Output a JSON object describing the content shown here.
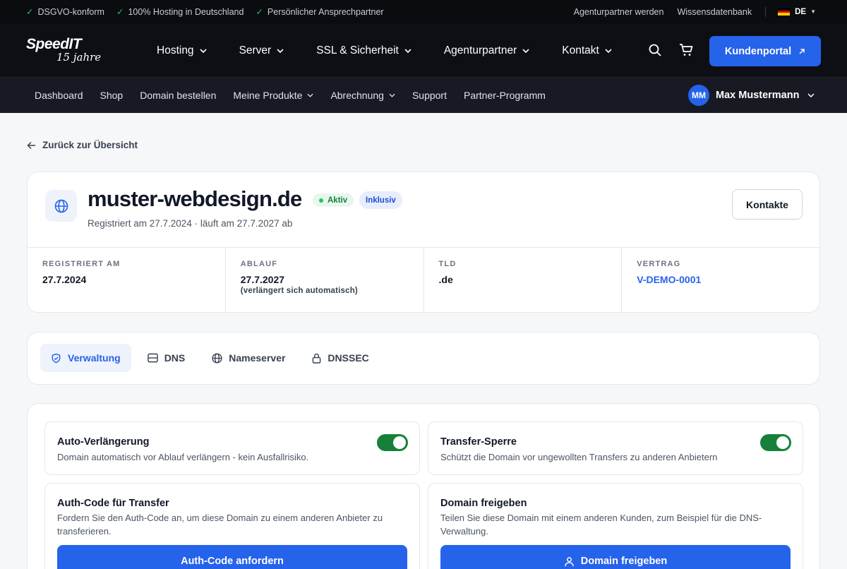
{
  "topbar": {
    "badges": [
      "DSGVO-konform",
      "100% Hosting in Deutschland",
      "Persönlicher Ansprechpartner"
    ],
    "links": [
      "Agenturpartner werden",
      "Wissensdatenbank"
    ],
    "language": "DE"
  },
  "logo": {
    "name": "SpeedIT",
    "tagline": "15 jahre"
  },
  "nav": {
    "items": [
      "Hosting",
      "Server",
      "SSL & Sicherheit",
      "Agenturpartner",
      "Kontakt"
    ],
    "portal_button": "Kundenportal"
  },
  "subnav": {
    "items": [
      {
        "label": "Dashboard",
        "dropdown": false
      },
      {
        "label": "Shop",
        "dropdown": false
      },
      {
        "label": "Domain bestellen",
        "dropdown": false
      },
      {
        "label": "Meine Produkte",
        "dropdown": true
      },
      {
        "label": "Abrechnung",
        "dropdown": true
      },
      {
        "label": "Support",
        "dropdown": false
      },
      {
        "label": "Partner-Programm",
        "dropdown": false
      }
    ],
    "user": {
      "initials": "MM",
      "name": "Max Mustermann"
    }
  },
  "back_link": "Zurück zur Übersicht",
  "domain": {
    "name": "muster-webdesign.de",
    "status": "Aktiv",
    "plan": "Inklusiv",
    "subtitle": "Registriert am 27.7.2024 · läuft am 27.7.2027 ab",
    "contacts_button": "Kontakte",
    "stats": {
      "registered_label": "REGISTRIERT AM",
      "registered_value": "27.7.2024",
      "expiry_label": "ABLAUF",
      "expiry_value": "27.7.2027",
      "expiry_note": "(verlängert sich automatisch)",
      "tld_label": "TLD",
      "tld_value": ".de",
      "contract_label": "VERTRAG",
      "contract_value": "V-DEMO-0001"
    }
  },
  "tabs": [
    "Verwaltung",
    "DNS",
    "Nameserver",
    "DNSSEC"
  ],
  "active_tab": "Verwaltung",
  "settings": {
    "auto_renew": {
      "title": "Auto-Verlängerung",
      "desc": "Domain automatisch vor Ablauf verlängern - kein Ausfallrisiko.",
      "enabled": true
    },
    "transfer_lock": {
      "title": "Transfer-Sperre",
      "desc": "Schützt die Domain vor ungewollten Transfers zu anderen Anbietern",
      "enabled": true
    },
    "auth_code": {
      "title": "Auth-Code für Transfer",
      "desc": "Fordern Sie den Auth-Code an, um diese Domain zu einem anderen Anbieter zu transferieren.",
      "button": "Auth-Code anfordern"
    },
    "share": {
      "title": "Domain freigeben",
      "desc": "Teilen Sie diese Domain mit einem anderen Kunden, zum Beispiel für die DNS-Verwaltung.",
      "button": "Domain freigeben"
    }
  },
  "colors": {
    "accent": "#2563eb",
    "toggle_on": "#16803a",
    "status_green": "#22c55e",
    "topbar_bg": "#0b0c10",
    "subnav_bg": "#171923"
  }
}
